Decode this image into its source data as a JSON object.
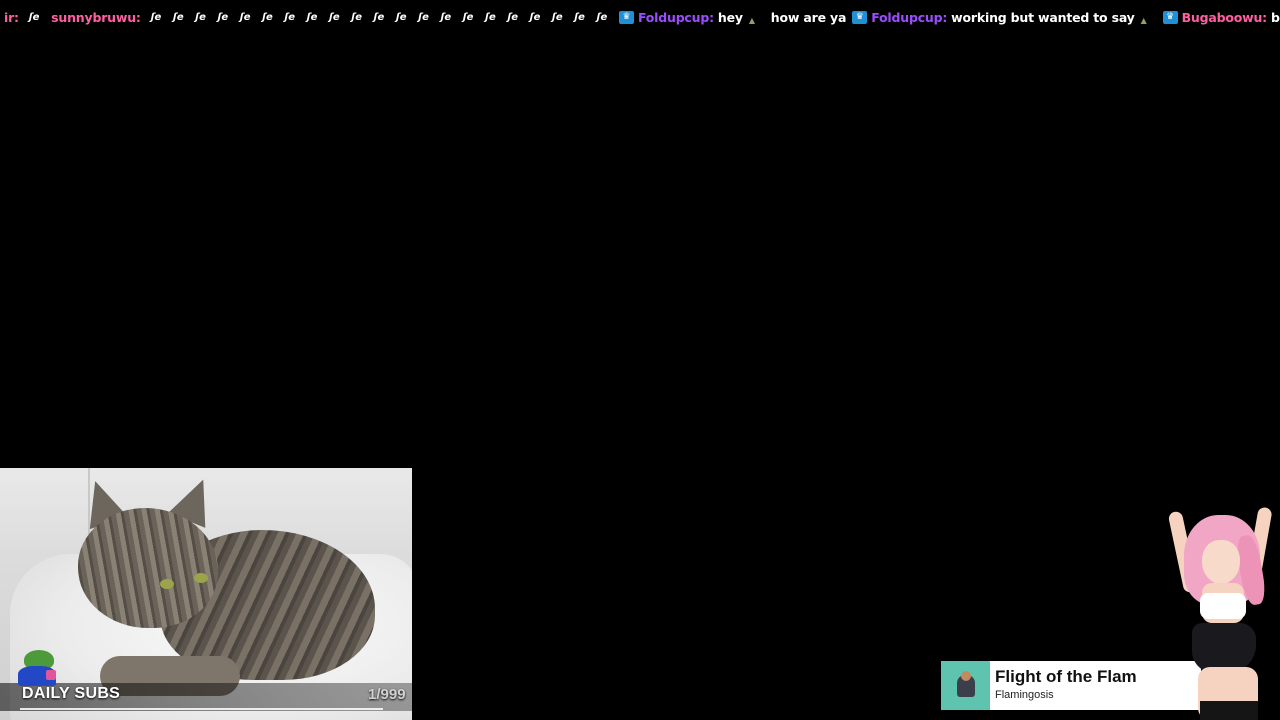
{
  "chat": {
    "messages": [
      {
        "user": "ir:",
        "user_color": "#ff5fa2",
        "badge": false,
        "text": "",
        "emote_count": 1
      },
      {
        "user": "sunnybruwu:",
        "user_color": "#ff5fa2",
        "badge": false,
        "text": "",
        "emote_count": 21
      },
      {
        "user": "Foldupcup:",
        "user_color": "#9b4dff",
        "badge": true,
        "text": "hey",
        "emote_count": 0,
        "trailing_icon": true
      },
      {
        "user": "",
        "user_color": "#ffffff",
        "badge": false,
        "text": "how are ya",
        "emote_count": 0
      },
      {
        "user": "Foldupcup:",
        "user_color": "#9b4dff",
        "badge": true,
        "text": "working but wanted to say",
        "emote_count": 0,
        "trailing_icon": true
      },
      {
        "user": "Bugaboowu:",
        "user_color": "#ff5fa2",
        "badge": true,
        "text": "babbyy",
        "emote_count": 0
      }
    ],
    "emote_glyph": "ʃe",
    "badge_icon": "crown-icon",
    "trailing_icon": "up-triangle-icon"
  },
  "daily_subs": {
    "label": "DAILY SUBS",
    "count": "1/999",
    "progress_fraction": 0.001
  },
  "now_playing": {
    "title": "Flight of the Flam",
    "artist": "Flamingosis",
    "accent": "#5ec4b0"
  },
  "colors": {
    "background": "#000000",
    "sub_badge": "#1f8fd6",
    "username_pink": "#ff5fa2",
    "username_purple": "#9b4dff"
  }
}
